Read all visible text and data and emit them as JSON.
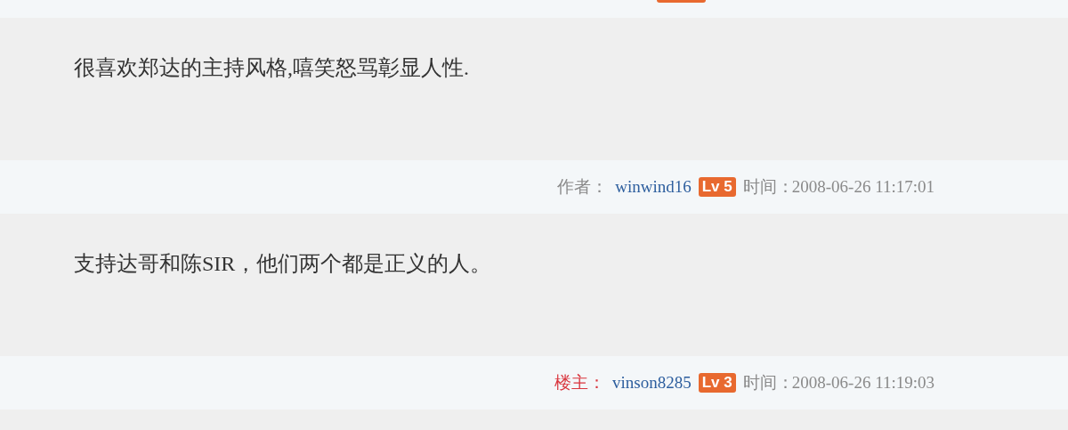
{
  "posts": [
    {
      "content": "很喜欢郑达的主持风格,嘻笑怒骂彰显人性.",
      "author": {
        "kind": "author",
        "role": "作者：",
        "name": "winwind16",
        "level_badge": "Lv 5",
        "time_label": "时间：",
        "time": "2008-06-26 11:17:01"
      }
    },
    {
      "content": "支持达哥和陈SIR，他们两个都是正义的人。",
      "author": {
        "kind": "owner",
        "role": "楼主：",
        "name": "vinson8285",
        "level_badge": "Lv 3",
        "time_label": "时间：",
        "time": "2008-06-26 11:19:03"
      }
    }
  ]
}
